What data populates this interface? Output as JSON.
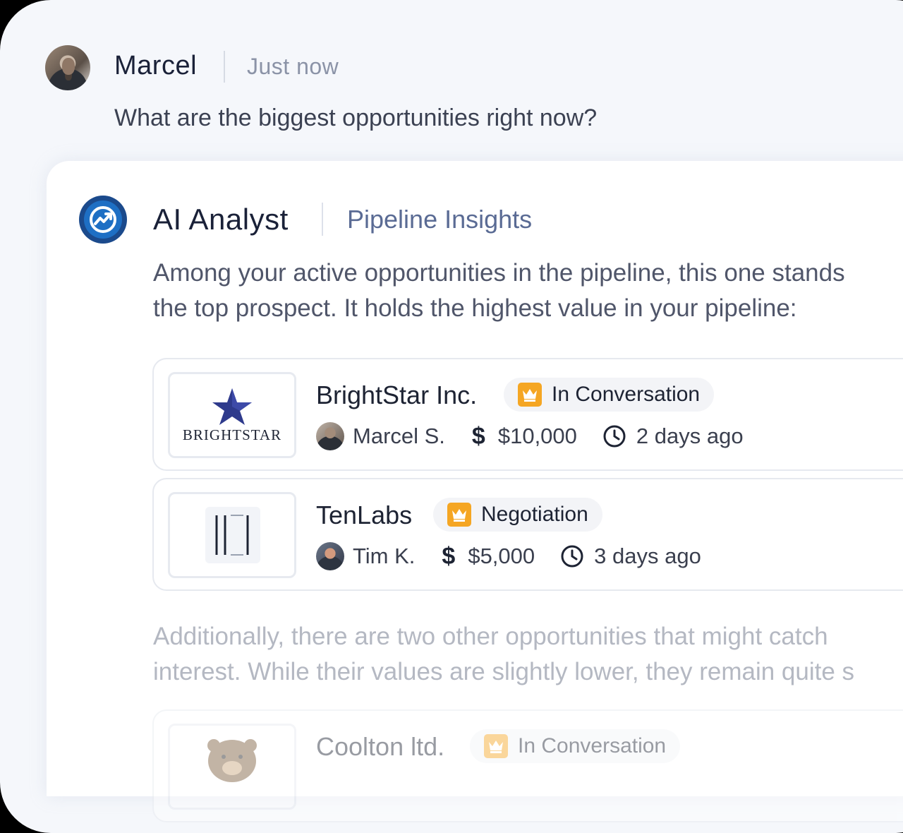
{
  "user_message": {
    "name": "Marcel",
    "time": "Just now",
    "text": "What are the biggest opportunities right now?"
  },
  "ai_response": {
    "name": "AI Analyst",
    "topic": "Pipeline Insights",
    "intro_lines": [
      "Among your active opportunities in the pipeline, this one stands",
      "the top prospect. It holds the highest value in your pipeline:"
    ],
    "followup_lines": [
      "Additionally, there are two other opportunities that might catch",
      "interest. While their values are slightly lower, they remain quite s"
    ]
  },
  "opportunities": [
    {
      "company": "BrightStar Inc.",
      "logo_text": "BRIGHTSTAR",
      "stage": "In Conversation",
      "owner": "Marcel S.",
      "value": "$10,000",
      "age": "2 days ago"
    },
    {
      "company": "TenLabs",
      "stage": "Negotiation",
      "owner": "Tim K.",
      "value": "$5,000",
      "age": "3 days ago"
    },
    {
      "company": "Coolton ltd.",
      "stage": "In Conversation"
    }
  ],
  "colors": {
    "background": "#f5f7fb",
    "card": "#ffffff",
    "accent_blue": "#1e6fc4",
    "badge_crown": "#f5a623",
    "brightstar_blue": "#2e3a8c"
  },
  "icons": [
    "user-avatar",
    "ai-analyst-icon",
    "crown-icon",
    "dollar-icon",
    "clock-icon",
    "owner-avatar"
  ]
}
